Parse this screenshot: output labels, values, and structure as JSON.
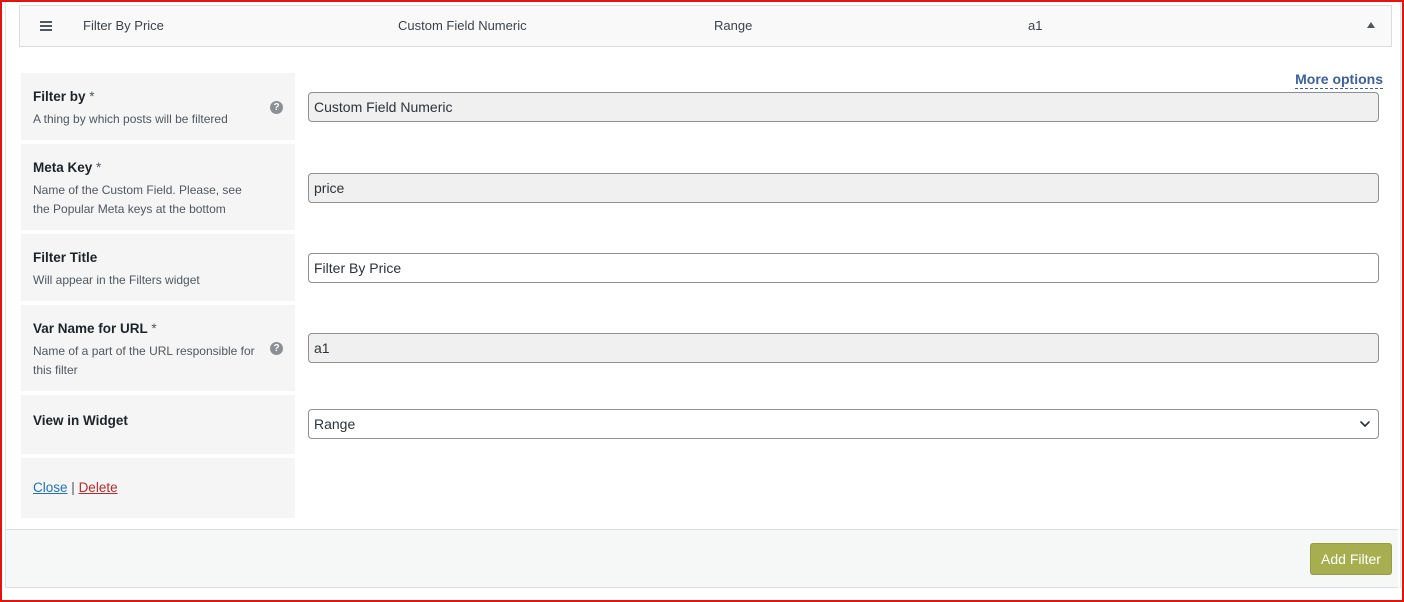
{
  "header": {
    "filter_title": "Filter By Price",
    "filter_by": "Custom Field Numeric",
    "view": "Range",
    "var_name": "a1"
  },
  "more_options": "More options",
  "fields": {
    "filter_by": {
      "label": "Filter by",
      "required": "*",
      "description": "A thing by which posts will be filtered",
      "value": "Custom Field Numeric"
    },
    "meta_key": {
      "label": "Meta Key",
      "required": "*",
      "description": "Name of the Custom Field. Please, see the Popular Meta keys at the bottom",
      "value": "price"
    },
    "filter_title": {
      "label": "Filter Title",
      "description": "Will appear in the Filters widget",
      "value": "Filter By Price"
    },
    "var_name": {
      "label": "Var Name for URL",
      "required": "*",
      "description": "Name of a part of the URL responsible for this filter",
      "value": "a1"
    },
    "view_in_widget": {
      "label": "View in Widget",
      "value": "Range"
    }
  },
  "actions": {
    "close": "Close",
    "separator": "|",
    "delete": "Delete"
  },
  "footer": {
    "add_filter": "Add Filter"
  },
  "icons": {
    "menu": "hamburger-icon",
    "collapse": "caret-up-icon",
    "help": "question-circle-icon",
    "select": "chevron-down-icon"
  },
  "colors": {
    "outer_border": "#e3140f",
    "link": "#3e5f99",
    "button": "#a6ae50",
    "label_bg": "#f5f5f5"
  }
}
